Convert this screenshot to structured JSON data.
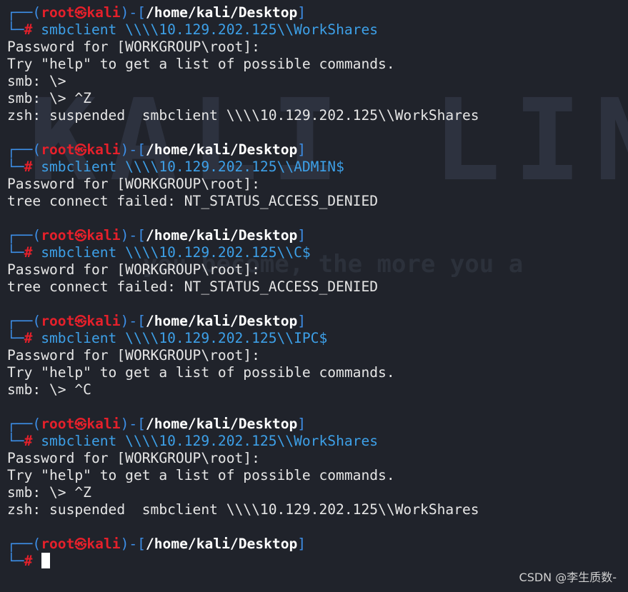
{
  "background": {
    "logo_text": "KALI LINUX",
    "tagline": "you become, the more you a"
  },
  "prompt": {
    "user": "root",
    "host": "kali",
    "cwd": "/home/kali/Desktop",
    "symbol": "#",
    "skull": "㉿"
  },
  "blocks": [
    {
      "command": "smbclient \\\\\\\\10.129.202.125\\\\WorkShares",
      "output": [
        "Password for [WORKGROUP\\root]:",
        "Try \"help\" to get a list of possible commands.",
        "smb: \\>",
        "smb: \\> ^Z",
        "zsh: suspended  smbclient \\\\\\\\10.129.202.125\\\\WorkShares"
      ]
    },
    {
      "command": "smbclient \\\\\\\\10.129.202.125\\\\ADMIN$",
      "output": [
        "Password for [WORKGROUP\\root]:",
        "tree connect failed: NT_STATUS_ACCESS_DENIED"
      ]
    },
    {
      "command": "smbclient \\\\\\\\10.129.202.125\\\\C$",
      "output": [
        "Password for [WORKGROUP\\root]:",
        "tree connect failed: NT_STATUS_ACCESS_DENIED"
      ]
    },
    {
      "command": "smbclient \\\\\\\\10.129.202.125\\\\IPC$",
      "output": [
        "Password for [WORKGROUP\\root]:",
        "Try \"help\" to get a list of possible commands.",
        "smb: \\> ^C"
      ]
    },
    {
      "command": "smbclient \\\\\\\\10.129.202.125\\\\WorkShares",
      "output": [
        "Password for [WORKGROUP\\root]:",
        "Try \"help\" to get a list of possible commands.",
        "smb: \\> ^Z",
        "zsh: suspended  smbclient \\\\\\\\10.129.202.125\\\\WorkShares"
      ]
    }
  ],
  "final_prompt": {
    "command": ""
  },
  "watermark": "CSDN @李生质数-"
}
